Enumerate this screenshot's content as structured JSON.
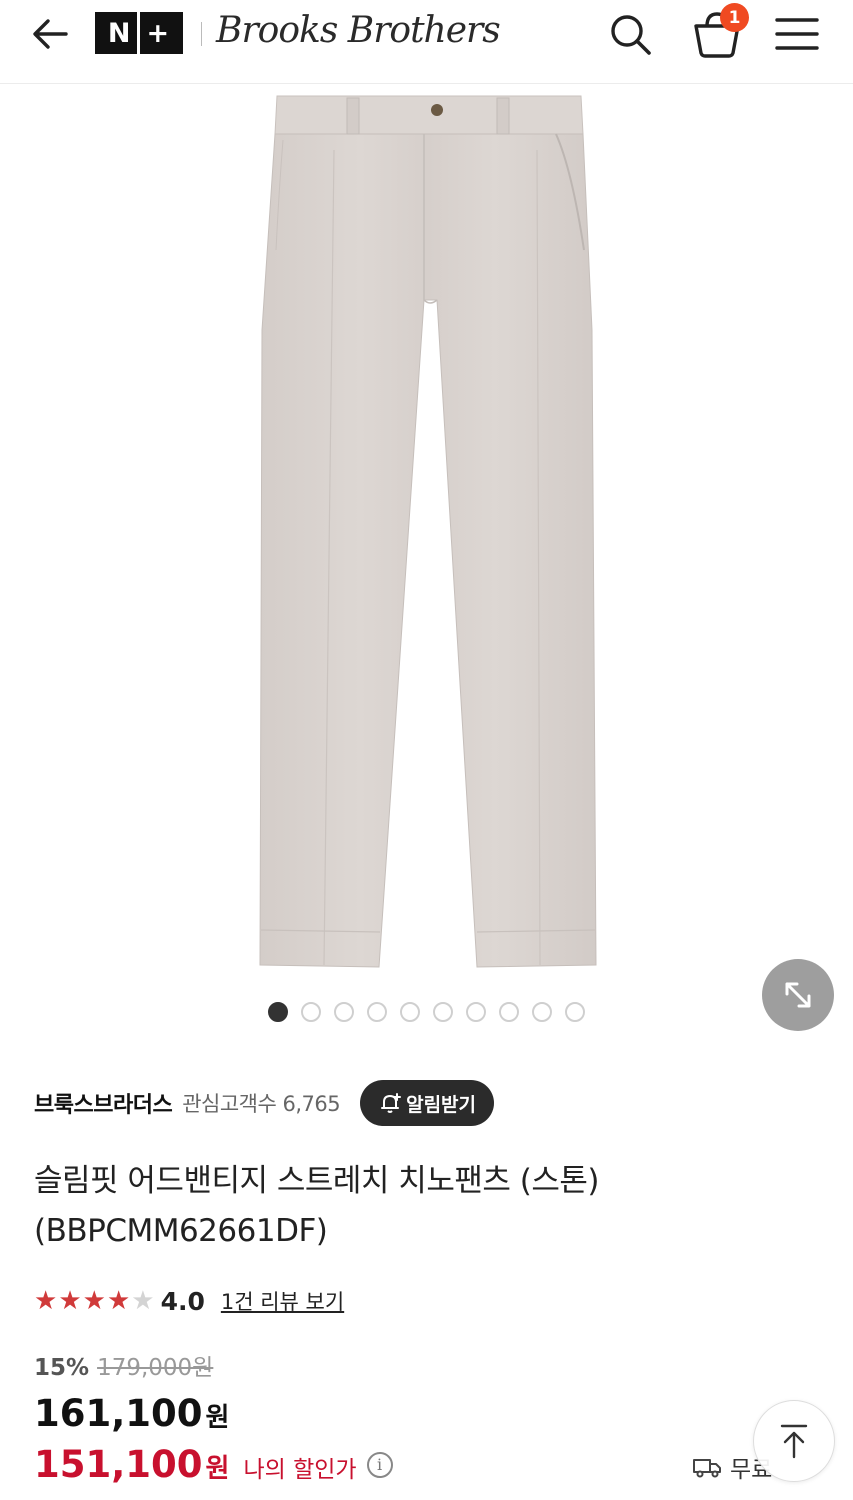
{
  "header": {
    "nplus_left": "N",
    "nplus_right": "+",
    "brand_logo": "Brooks Brothers",
    "cart_count": "1"
  },
  "gallery": {
    "total_images": 10,
    "active_index": 0
  },
  "product": {
    "brand": "브룩스브라더스",
    "followers": "관심고객수 6,765",
    "notify_label": "알림받기",
    "title_line1": "슬림핏 어드밴티지 스트레치 치노팬츠 (스톤)",
    "title_line2": "(BBPCMM62661DF)",
    "rating_value": "4.0",
    "rating_stars": 4,
    "review_link": "1건 리뷰 보기",
    "discount_rate": "15%",
    "original_price": "179,000원",
    "sale_price": "161,100",
    "sale_unit": "원",
    "my_price": "151,100",
    "my_unit": "원",
    "my_price_label": "나의 할인가",
    "shipping_label": "무료"
  },
  "colors": {
    "accent_red": "#c8102e",
    "badge": "#f04a22",
    "star": "#d03a3a",
    "pants": "#d9d3cf"
  }
}
